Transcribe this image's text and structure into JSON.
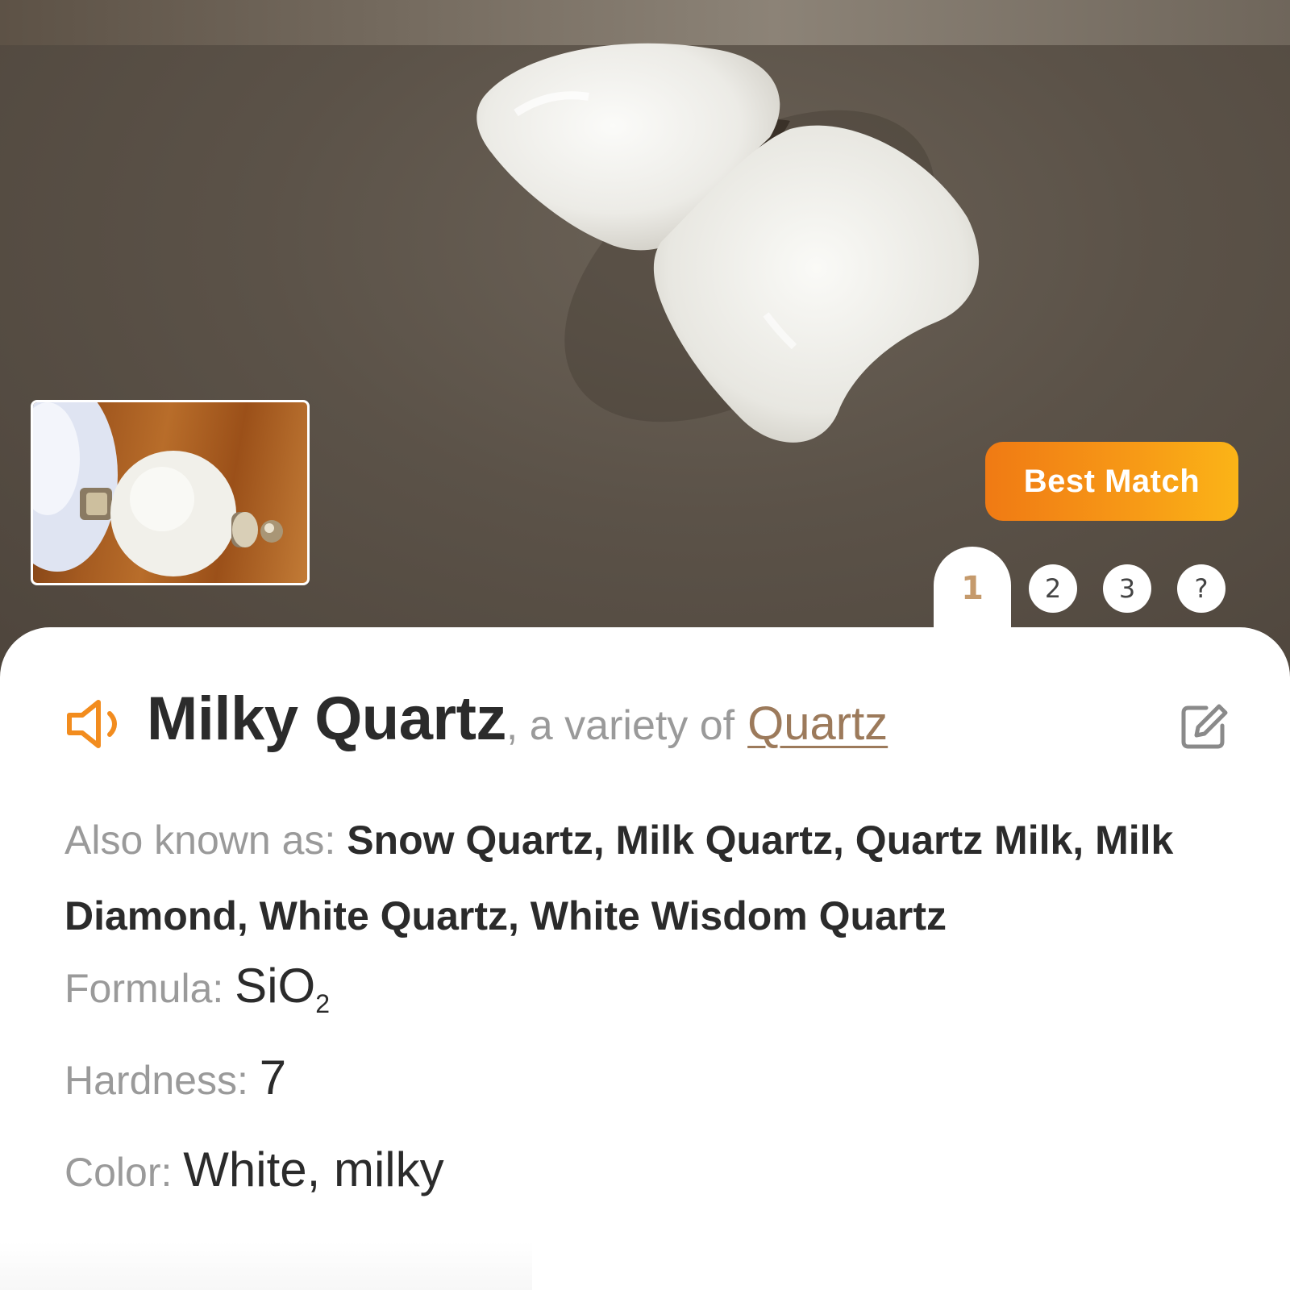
{
  "badge": {
    "label": "Best Match"
  },
  "tabs": [
    {
      "label": "1",
      "active": true
    },
    {
      "label": "2",
      "active": false
    },
    {
      "label": "3",
      "active": false
    },
    {
      "label": "?",
      "active": false
    }
  ],
  "result": {
    "name": "Milky Quartz",
    "variety_prefix": ", a variety of",
    "variety_link": "Quartz",
    "speaker_icon": "speaker-icon",
    "edit_icon": "edit-icon"
  },
  "details": {
    "also_known_as_label": "Also known as:",
    "also_known_as": "Snow Quartz, Milk Quartz, Quartz Milk, Milk Diamond, White Quartz, White Wisdom Quartz",
    "formula_label": "Formula:",
    "formula_main": "SiO",
    "formula_sub": "2",
    "hardness_label": "Hardness:",
    "hardness": "7",
    "color_label": "Color:",
    "color": "White, milky"
  },
  "colors": {
    "accent": "#F28C1E",
    "link": "#9C7A5B",
    "label_gray": "#9A9A9A",
    "text_dark": "#2B2B2B"
  }
}
